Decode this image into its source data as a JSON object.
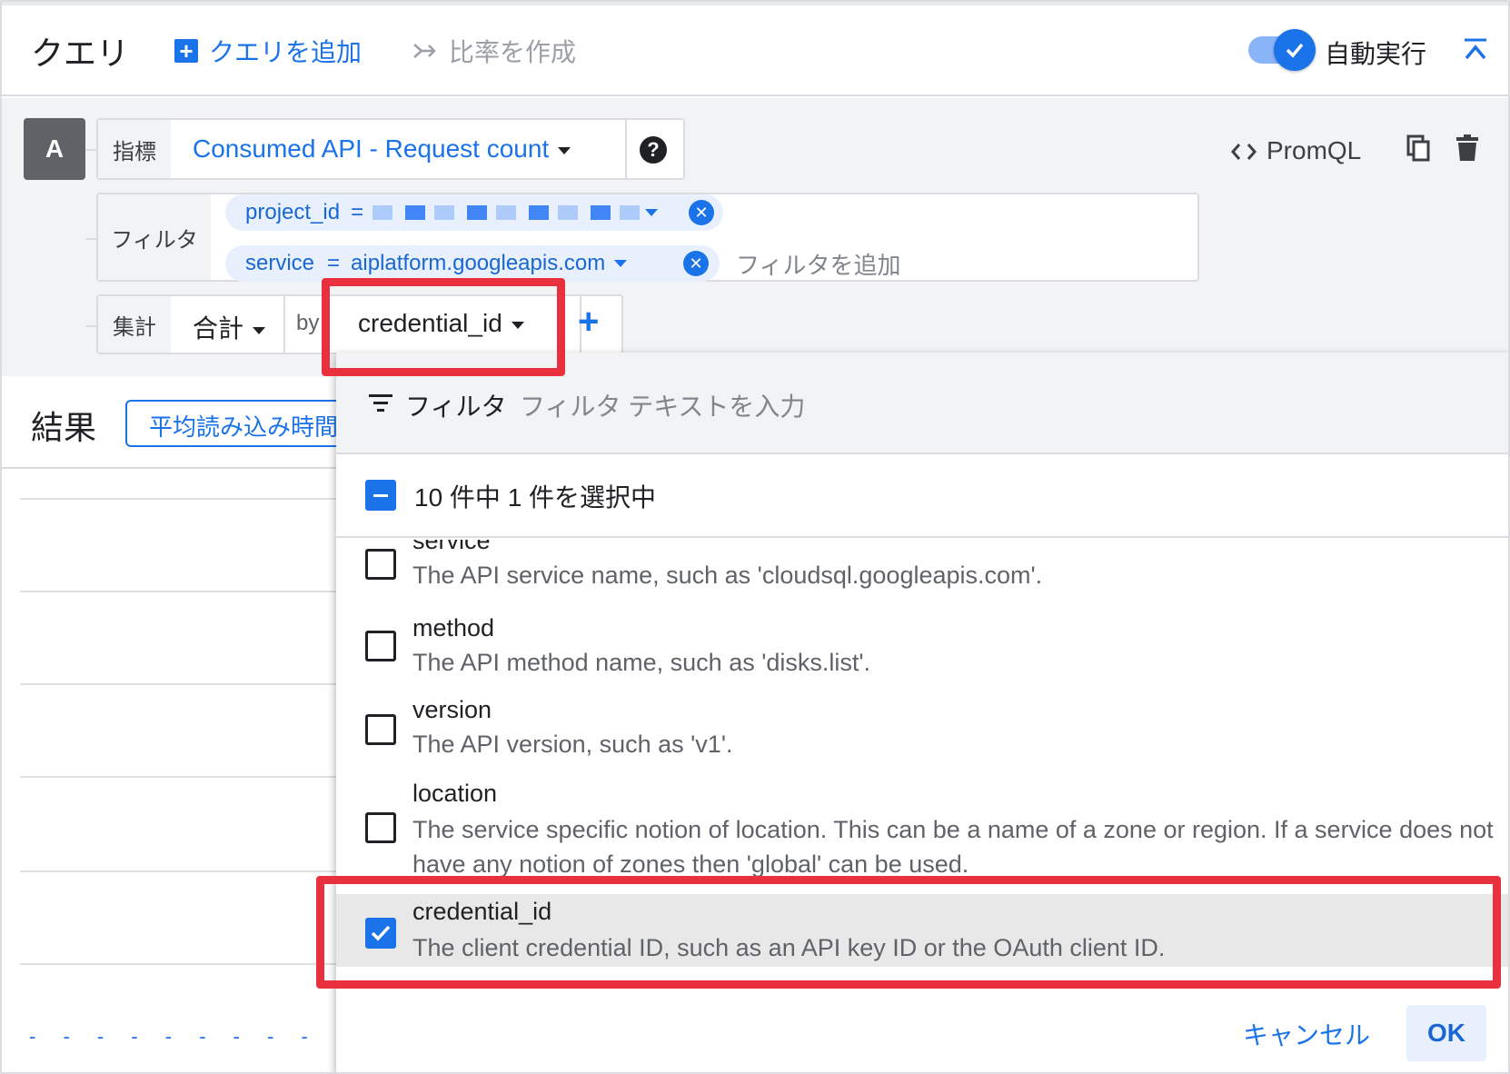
{
  "header": {
    "title": "クエリ",
    "add_query": "クエリを追加",
    "create_ratio": "比率を作成",
    "auto_run_label": "自動実行",
    "auto_run_on": true
  },
  "query": {
    "badge": "A",
    "metric_label": "指標",
    "metric_value": "Consumed API - Request count",
    "help_icon": "?",
    "promql": "PromQL",
    "filter_label": "フィルタ",
    "filters": [
      {
        "key": "project_id",
        "op": "=",
        "value": ""
      },
      {
        "key": "service",
        "op": "=",
        "value": "aiplatform.googleapis.com"
      }
    ],
    "add_filter": "フィルタを追加",
    "agg_label": "集計",
    "agg_value": "合計",
    "by_label": "by",
    "group_by_value": "credential_id",
    "add_group_icon": "+"
  },
  "results": {
    "title": "結果",
    "button": "平均読み込み時間"
  },
  "dropdown": {
    "filter_label": "フィルタ",
    "filter_placeholder": "フィルタ テキストを入力",
    "selection_count": "10 件中 1 件を選択中",
    "items": [
      {
        "name": "service",
        "desc": "The API service name, such as 'cloudsql.googleapis.com'.",
        "checked": false
      },
      {
        "name": "method",
        "desc": "The API method name, such as 'disks.list'.",
        "checked": false
      },
      {
        "name": "version",
        "desc": "The API version, such as 'v1'.",
        "checked": false
      },
      {
        "name": "location",
        "desc": "The service specific notion of location. This can be a name of a zone or region. If a service does not have any notion of zones then 'global' can be used.",
        "checked": false
      },
      {
        "name": "credential_id",
        "desc": "The client credential ID, such as an API key ID or the OAuth client ID.",
        "checked": true
      }
    ],
    "cancel": "キャンセル",
    "ok": "OK"
  },
  "colors": {
    "accent": "#1a73e8",
    "highlight_border": "#e8303e"
  }
}
